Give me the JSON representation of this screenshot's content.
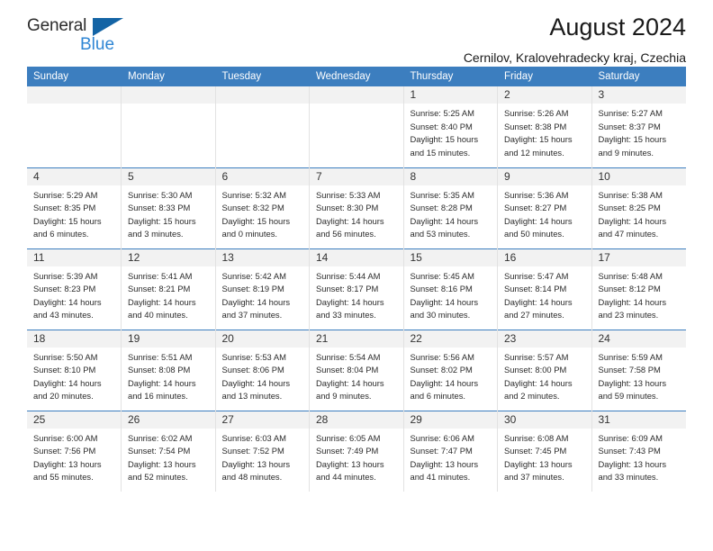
{
  "brand": {
    "name_part1": "General",
    "name_part2": "Blue",
    "logo_icon": "blue-triangle-icon",
    "accent_dark": "#1464a5",
    "accent_light": "#2f86d4"
  },
  "header": {
    "title": "August 2024",
    "subtitle": "Cernilov, Kralovehradecky kraj, Czechia"
  },
  "colors": {
    "header_row_bg": "#3c7ebf",
    "day_number_bg": "#f2f2f2",
    "cell_border": "#e2e2e2",
    "text": "#2b2b2b"
  },
  "weekday_headers": [
    "Sunday",
    "Monday",
    "Tuesday",
    "Wednesday",
    "Thursday",
    "Friday",
    "Saturday"
  ],
  "weeks": [
    [
      {
        "day": "",
        "empty": true,
        "sunrise": "",
        "sunset": "",
        "daylight_line1": "",
        "daylight_line2": ""
      },
      {
        "day": "",
        "empty": true,
        "sunrise": "",
        "sunset": "",
        "daylight_line1": "",
        "daylight_line2": ""
      },
      {
        "day": "",
        "empty": true,
        "sunrise": "",
        "sunset": "",
        "daylight_line1": "",
        "daylight_line2": ""
      },
      {
        "day": "",
        "empty": true,
        "sunrise": "",
        "sunset": "",
        "daylight_line1": "",
        "daylight_line2": ""
      },
      {
        "day": "1",
        "empty": false,
        "sunrise": "Sunrise: 5:25 AM",
        "sunset": "Sunset: 8:40 PM",
        "daylight_line1": "Daylight: 15 hours",
        "daylight_line2": "and 15 minutes."
      },
      {
        "day": "2",
        "empty": false,
        "sunrise": "Sunrise: 5:26 AM",
        "sunset": "Sunset: 8:38 PM",
        "daylight_line1": "Daylight: 15 hours",
        "daylight_line2": "and 12 minutes."
      },
      {
        "day": "3",
        "empty": false,
        "sunrise": "Sunrise: 5:27 AM",
        "sunset": "Sunset: 8:37 PM",
        "daylight_line1": "Daylight: 15 hours",
        "daylight_line2": "and 9 minutes."
      }
    ],
    [
      {
        "day": "4",
        "empty": false,
        "sunrise": "Sunrise: 5:29 AM",
        "sunset": "Sunset: 8:35 PM",
        "daylight_line1": "Daylight: 15 hours",
        "daylight_line2": "and 6 minutes."
      },
      {
        "day": "5",
        "empty": false,
        "sunrise": "Sunrise: 5:30 AM",
        "sunset": "Sunset: 8:33 PM",
        "daylight_line1": "Daylight: 15 hours",
        "daylight_line2": "and 3 minutes."
      },
      {
        "day": "6",
        "empty": false,
        "sunrise": "Sunrise: 5:32 AM",
        "sunset": "Sunset: 8:32 PM",
        "daylight_line1": "Daylight: 15 hours",
        "daylight_line2": "and 0 minutes."
      },
      {
        "day": "7",
        "empty": false,
        "sunrise": "Sunrise: 5:33 AM",
        "sunset": "Sunset: 8:30 PM",
        "daylight_line1": "Daylight: 14 hours",
        "daylight_line2": "and 56 minutes."
      },
      {
        "day": "8",
        "empty": false,
        "sunrise": "Sunrise: 5:35 AM",
        "sunset": "Sunset: 8:28 PM",
        "daylight_line1": "Daylight: 14 hours",
        "daylight_line2": "and 53 minutes."
      },
      {
        "day": "9",
        "empty": false,
        "sunrise": "Sunrise: 5:36 AM",
        "sunset": "Sunset: 8:27 PM",
        "daylight_line1": "Daylight: 14 hours",
        "daylight_line2": "and 50 minutes."
      },
      {
        "day": "10",
        "empty": false,
        "sunrise": "Sunrise: 5:38 AM",
        "sunset": "Sunset: 8:25 PM",
        "daylight_line1": "Daylight: 14 hours",
        "daylight_line2": "and 47 minutes."
      }
    ],
    [
      {
        "day": "11",
        "empty": false,
        "sunrise": "Sunrise: 5:39 AM",
        "sunset": "Sunset: 8:23 PM",
        "daylight_line1": "Daylight: 14 hours",
        "daylight_line2": "and 43 minutes."
      },
      {
        "day": "12",
        "empty": false,
        "sunrise": "Sunrise: 5:41 AM",
        "sunset": "Sunset: 8:21 PM",
        "daylight_line1": "Daylight: 14 hours",
        "daylight_line2": "and 40 minutes."
      },
      {
        "day": "13",
        "empty": false,
        "sunrise": "Sunrise: 5:42 AM",
        "sunset": "Sunset: 8:19 PM",
        "daylight_line1": "Daylight: 14 hours",
        "daylight_line2": "and 37 minutes."
      },
      {
        "day": "14",
        "empty": false,
        "sunrise": "Sunrise: 5:44 AM",
        "sunset": "Sunset: 8:17 PM",
        "daylight_line1": "Daylight: 14 hours",
        "daylight_line2": "and 33 minutes."
      },
      {
        "day": "15",
        "empty": false,
        "sunrise": "Sunrise: 5:45 AM",
        "sunset": "Sunset: 8:16 PM",
        "daylight_line1": "Daylight: 14 hours",
        "daylight_line2": "and 30 minutes."
      },
      {
        "day": "16",
        "empty": false,
        "sunrise": "Sunrise: 5:47 AM",
        "sunset": "Sunset: 8:14 PM",
        "daylight_line1": "Daylight: 14 hours",
        "daylight_line2": "and 27 minutes."
      },
      {
        "day": "17",
        "empty": false,
        "sunrise": "Sunrise: 5:48 AM",
        "sunset": "Sunset: 8:12 PM",
        "daylight_line1": "Daylight: 14 hours",
        "daylight_line2": "and 23 minutes."
      }
    ],
    [
      {
        "day": "18",
        "empty": false,
        "sunrise": "Sunrise: 5:50 AM",
        "sunset": "Sunset: 8:10 PM",
        "daylight_line1": "Daylight: 14 hours",
        "daylight_line2": "and 20 minutes."
      },
      {
        "day": "19",
        "empty": false,
        "sunrise": "Sunrise: 5:51 AM",
        "sunset": "Sunset: 8:08 PM",
        "daylight_line1": "Daylight: 14 hours",
        "daylight_line2": "and 16 minutes."
      },
      {
        "day": "20",
        "empty": false,
        "sunrise": "Sunrise: 5:53 AM",
        "sunset": "Sunset: 8:06 PM",
        "daylight_line1": "Daylight: 14 hours",
        "daylight_line2": "and 13 minutes."
      },
      {
        "day": "21",
        "empty": false,
        "sunrise": "Sunrise: 5:54 AM",
        "sunset": "Sunset: 8:04 PM",
        "daylight_line1": "Daylight: 14 hours",
        "daylight_line2": "and 9 minutes."
      },
      {
        "day": "22",
        "empty": false,
        "sunrise": "Sunrise: 5:56 AM",
        "sunset": "Sunset: 8:02 PM",
        "daylight_line1": "Daylight: 14 hours",
        "daylight_line2": "and 6 minutes."
      },
      {
        "day": "23",
        "empty": false,
        "sunrise": "Sunrise: 5:57 AM",
        "sunset": "Sunset: 8:00 PM",
        "daylight_line1": "Daylight: 14 hours",
        "daylight_line2": "and 2 minutes."
      },
      {
        "day": "24",
        "empty": false,
        "sunrise": "Sunrise: 5:59 AM",
        "sunset": "Sunset: 7:58 PM",
        "daylight_line1": "Daylight: 13 hours",
        "daylight_line2": "and 59 minutes."
      }
    ],
    [
      {
        "day": "25",
        "empty": false,
        "sunrise": "Sunrise: 6:00 AM",
        "sunset": "Sunset: 7:56 PM",
        "daylight_line1": "Daylight: 13 hours",
        "daylight_line2": "and 55 minutes."
      },
      {
        "day": "26",
        "empty": false,
        "sunrise": "Sunrise: 6:02 AM",
        "sunset": "Sunset: 7:54 PM",
        "daylight_line1": "Daylight: 13 hours",
        "daylight_line2": "and 52 minutes."
      },
      {
        "day": "27",
        "empty": false,
        "sunrise": "Sunrise: 6:03 AM",
        "sunset": "Sunset: 7:52 PM",
        "daylight_line1": "Daylight: 13 hours",
        "daylight_line2": "and 48 minutes."
      },
      {
        "day": "28",
        "empty": false,
        "sunrise": "Sunrise: 6:05 AM",
        "sunset": "Sunset: 7:49 PM",
        "daylight_line1": "Daylight: 13 hours",
        "daylight_line2": "and 44 minutes."
      },
      {
        "day": "29",
        "empty": false,
        "sunrise": "Sunrise: 6:06 AM",
        "sunset": "Sunset: 7:47 PM",
        "daylight_line1": "Daylight: 13 hours",
        "daylight_line2": "and 41 minutes."
      },
      {
        "day": "30",
        "empty": false,
        "sunrise": "Sunrise: 6:08 AM",
        "sunset": "Sunset: 7:45 PM",
        "daylight_line1": "Daylight: 13 hours",
        "daylight_line2": "and 37 minutes."
      },
      {
        "day": "31",
        "empty": false,
        "sunrise": "Sunrise: 6:09 AM",
        "sunset": "Sunset: 7:43 PM",
        "daylight_line1": "Daylight: 13 hours",
        "daylight_line2": "and 33 minutes."
      }
    ]
  ]
}
